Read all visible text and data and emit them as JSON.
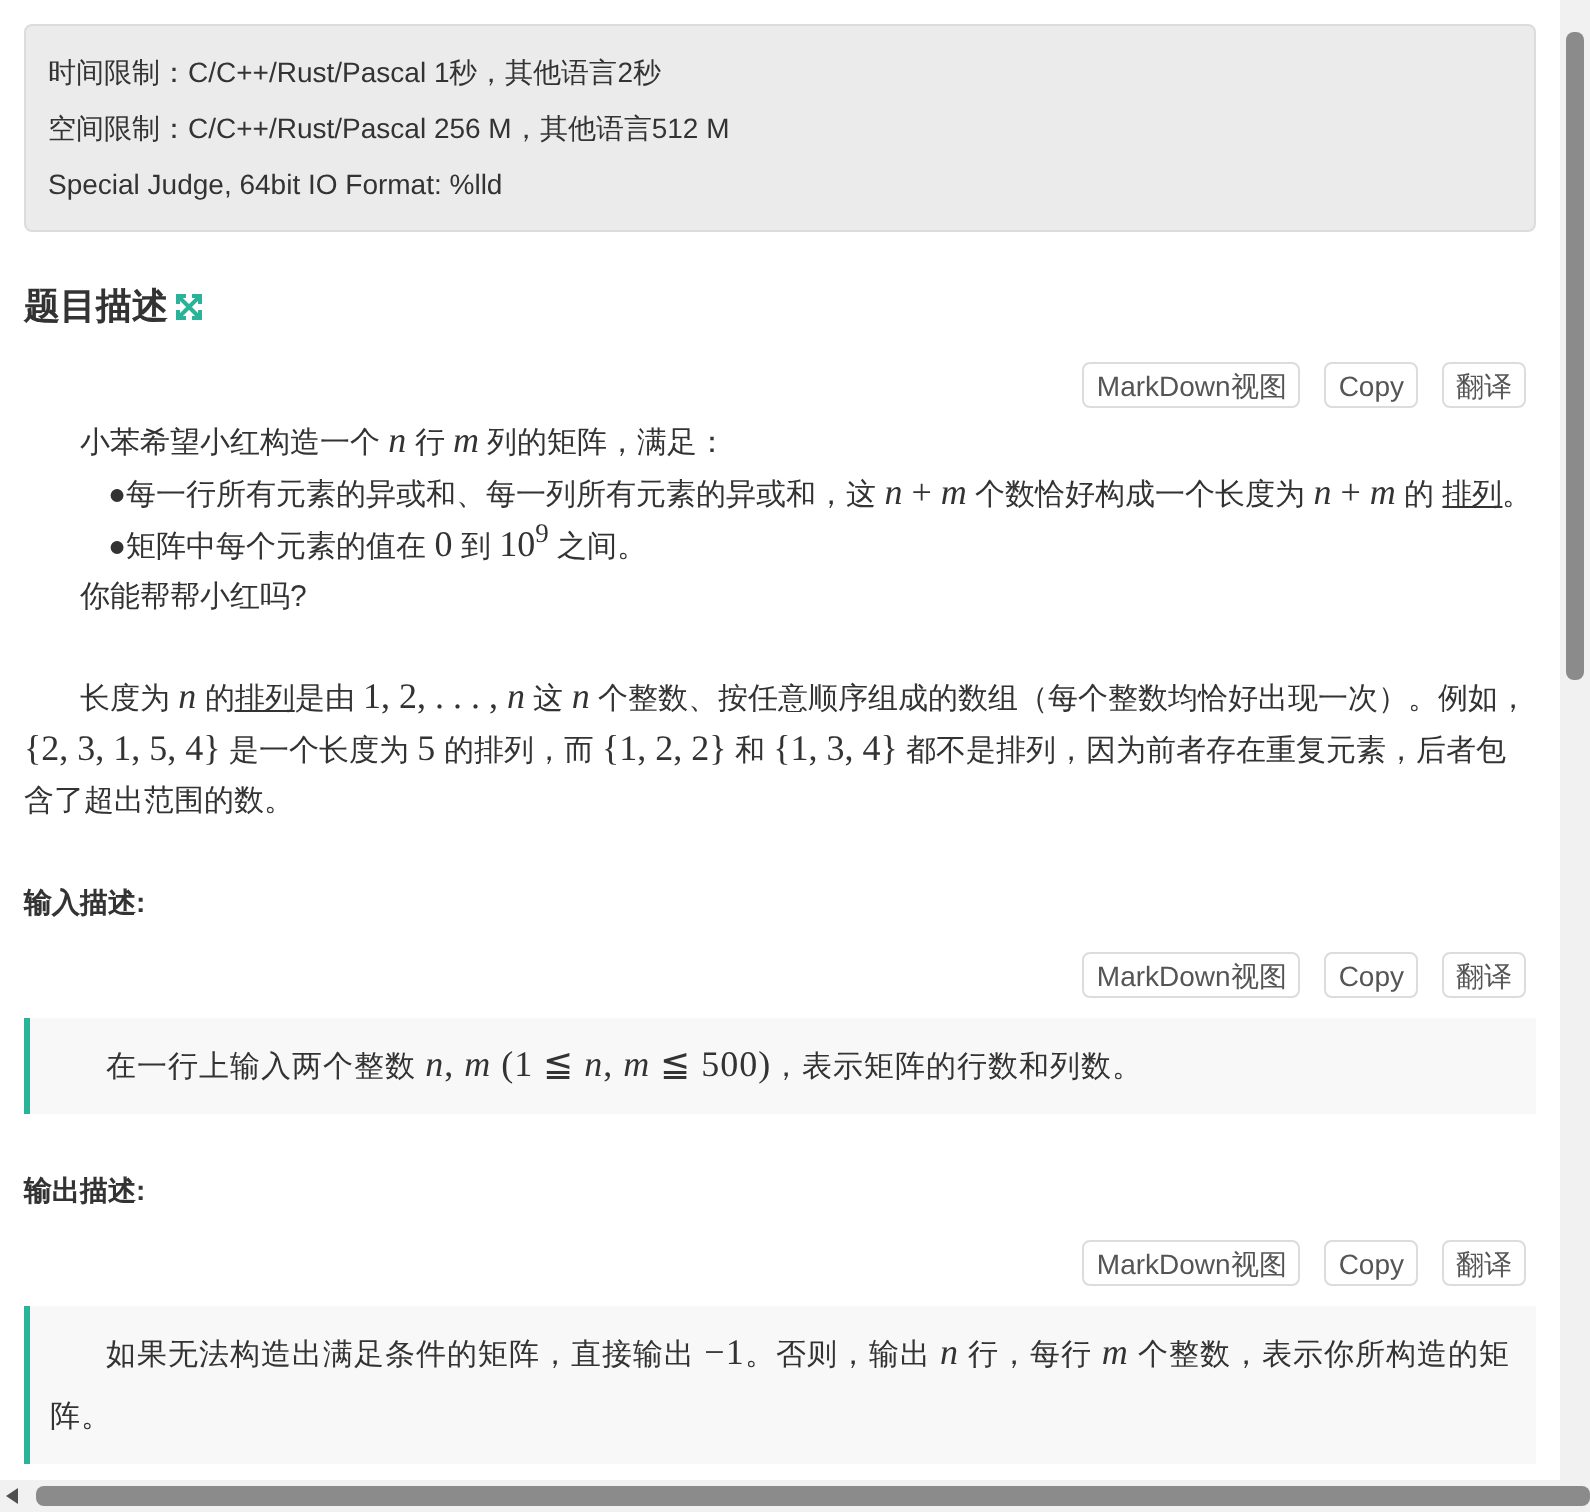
{
  "limits": [
    "时间限制：C/C++/Rust/Pascal 1秒，其他语言2秒",
    "空间限制：C/C++/Rust/Pascal 256 M，其他语言512 M",
    "Special Judge, 64bit IO Format: %lld"
  ],
  "sections": [
    {
      "kind": "description",
      "title": "题目描述",
      "toolbar": [
        "MarkDown视图",
        "Copy",
        "翻译"
      ],
      "paragraphs": [
        {
          "kind": "indent",
          "parts": [
            {
              "kind": "text",
              "text": "小苯希望小红构造一个 "
            },
            {
              "kind": "math",
              "text": "*n*"
            },
            {
              "kind": "text",
              "text": " 行 "
            },
            {
              "kind": "math",
              "text": "*m*"
            },
            {
              "kind": "text",
              "text": " 列的矩阵，满足："
            }
          ]
        },
        {
          "kind": "bullet",
          "bullet": "●",
          "parts": [
            {
              "kind": "text",
              "text": "每一行所有元素的异或和、每一列所有元素的异或和，这 "
            },
            {
              "kind": "math",
              "text": "*n* + *m*"
            },
            {
              "kind": "text",
              "text": " 个数恰好构成一个长度为 "
            },
            {
              "kind": "math",
              "text": "*n* + *m*"
            },
            {
              "kind": "text",
              "text": " 的 "
            },
            {
              "kind": "link",
              "text": "排列"
            },
            {
              "kind": "text",
              "text": "。"
            }
          ]
        },
        {
          "kind": "bullet",
          "bullet": "●",
          "parts": [
            {
              "kind": "text",
              "text": "矩阵中每个元素的值在 "
            },
            {
              "kind": "math",
              "text": "0"
            },
            {
              "kind": "text",
              "text": " 到 "
            },
            {
              "kind": "math",
              "text": "10$^{9}$"
            },
            {
              "kind": "text",
              "text": " 之间。"
            }
          ]
        },
        {
          "kind": "indent",
          "parts": [
            {
              "kind": "text",
              "text": "你能帮帮小红吗?"
            }
          ]
        },
        {
          "kind": "gap"
        },
        {
          "kind": "indent",
          "parts": [
            {
              "kind": "text",
              "text": "长度为 "
            },
            {
              "kind": "math",
              "text": "*n*"
            },
            {
              "kind": "text",
              "text": " 的"
            },
            {
              "kind": "link",
              "text": "排列"
            },
            {
              "kind": "text",
              "text": "是由 "
            },
            {
              "kind": "math",
              "text": "1, 2, . . . , *n*"
            },
            {
              "kind": "text",
              "text": " 这 "
            },
            {
              "kind": "math",
              "text": "*n*"
            },
            {
              "kind": "text",
              "text": " 个整数、按任意顺序组成的数组（每个整数均恰好出现一次）。例如，"
            },
            {
              "kind": "math",
              "text": "{2, 3, 1, 5, 4}"
            },
            {
              "kind": "text",
              "text": " 是一个长度为 "
            },
            {
              "kind": "math",
              "text": "5"
            },
            {
              "kind": "text",
              "text": " 的排列，而 "
            },
            {
              "kind": "math",
              "text": "{1, 2, 2}"
            },
            {
              "kind": "text",
              "text": " 和 "
            },
            {
              "kind": "math",
              "text": "{1, 3, 4}"
            },
            {
              "kind": "text",
              "text": " 都不是排列，因为前者存在重复元素，后者包含了超出范围的数。"
            }
          ]
        }
      ]
    },
    {
      "kind": "io",
      "title": "输入描述:",
      "toolbar": [
        "MarkDown视图",
        "Copy",
        "翻译"
      ],
      "paragraphs": [
        {
          "kind": "indent",
          "parts": [
            {
              "kind": "text",
              "text": "在一行上输入两个整数 "
            },
            {
              "kind": "math",
              "text": "*n*, *m* (1 ≦ *n*, *m* ≦ 500)"
            },
            {
              "kind": "text",
              "text": "，表示矩阵的行数和列数。"
            }
          ]
        }
      ]
    },
    {
      "kind": "io",
      "title": "输出描述:",
      "toolbar": [
        "MarkDown视图",
        "Copy",
        "翻译"
      ],
      "paragraphs": [
        {
          "kind": "indent",
          "parts": [
            {
              "kind": "text",
              "text": "如果无法构造出满足条件的矩阵，直接输出 "
            },
            {
              "kind": "math",
              "text": "−1"
            },
            {
              "kind": "text",
              "text": "。否则，输出 "
            },
            {
              "kind": "math",
              "text": "*n*"
            },
            {
              "kind": "text",
              "text": " 行，每行 "
            },
            {
              "kind": "math",
              "text": "*m*"
            },
            {
              "kind": "text",
              "text": " 个整数，表示你所构造的矩阵。"
            }
          ]
        }
      ]
    }
  ]
}
